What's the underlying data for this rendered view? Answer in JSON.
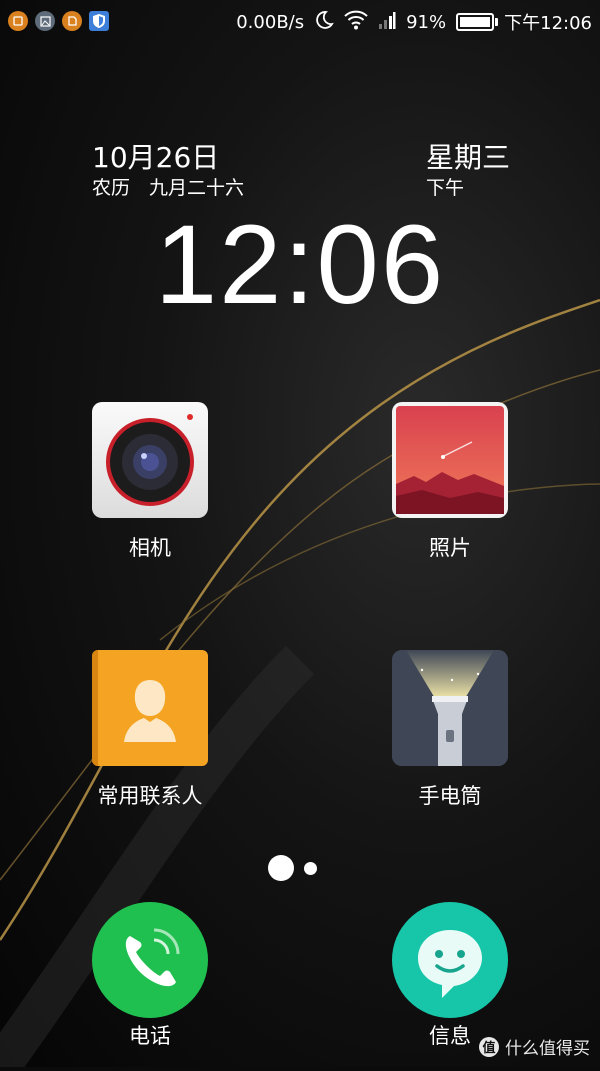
{
  "status_bar": {
    "net_speed": "0.00B/s",
    "battery_percent": "91%",
    "battery_level": 0.91,
    "time": "下午12:06",
    "notification_icons": [
      "app-orange-icon",
      "gallery-icon",
      "app-orange-icon",
      "shield-icon"
    ]
  },
  "lockscreen": {
    "date": "10月26日",
    "lunar_date": "农历　九月二十六",
    "weekday": "星期三",
    "ampm": "下午",
    "clock": "12:06"
  },
  "apps": [
    {
      "label": "相机",
      "icon": "camera-icon"
    },
    {
      "label": "照片",
      "icon": "photos-icon"
    },
    {
      "label": "常用联系人",
      "icon": "contacts-icon"
    },
    {
      "label": "手电筒",
      "icon": "flashlight-icon"
    }
  ],
  "pager": {
    "pages": 2,
    "current": 1
  },
  "dock": [
    {
      "label": "电话",
      "icon": "phone-icon",
      "color": "#20c050"
    },
    {
      "label": "信息",
      "icon": "message-icon",
      "color": "#17c6a8"
    }
  ],
  "watermark": {
    "text": "什么值得买",
    "badge": "值"
  }
}
